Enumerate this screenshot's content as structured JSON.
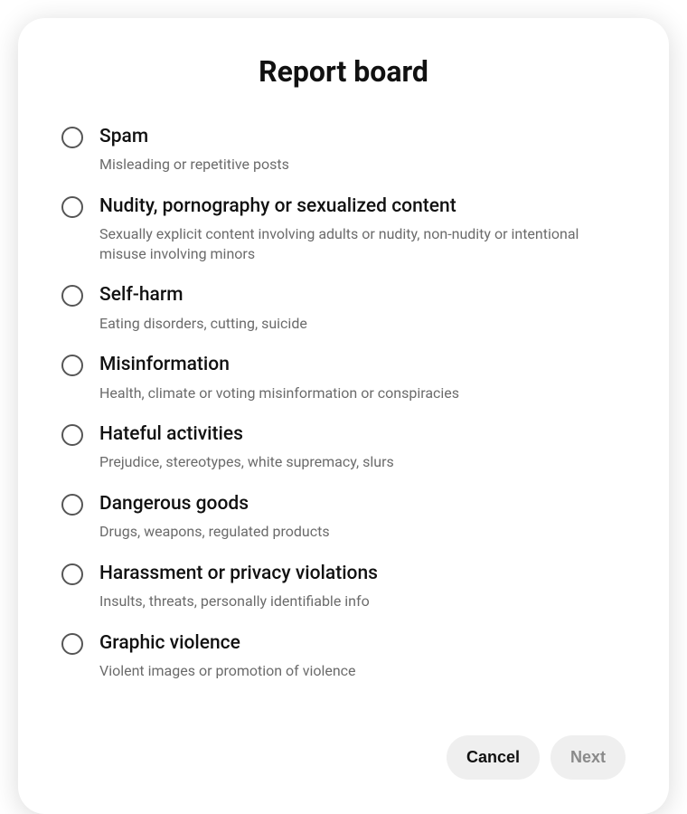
{
  "modal": {
    "title": "Report board",
    "options": [
      {
        "label": "Spam",
        "desc": "Misleading or repetitive posts"
      },
      {
        "label": "Nudity, pornography or sexualized content",
        "desc": "Sexually explicit content involving adults or nudity, non-nudity or intentional misuse involving minors"
      },
      {
        "label": "Self-harm",
        "desc": "Eating disorders, cutting, suicide"
      },
      {
        "label": "Misinformation",
        "desc": "Health, climate or voting misinformation or conspiracies"
      },
      {
        "label": "Hateful activities",
        "desc": "Prejudice, stereotypes, white supremacy, slurs"
      },
      {
        "label": "Dangerous goods",
        "desc": "Drugs, weapons, regulated products"
      },
      {
        "label": "Harassment or privacy violations",
        "desc": "Insults, threats, personally identifiable info"
      },
      {
        "label": "Graphic violence",
        "desc": "Violent images or promotion of violence"
      }
    ],
    "buttons": {
      "cancel": "Cancel",
      "next": "Next"
    }
  }
}
